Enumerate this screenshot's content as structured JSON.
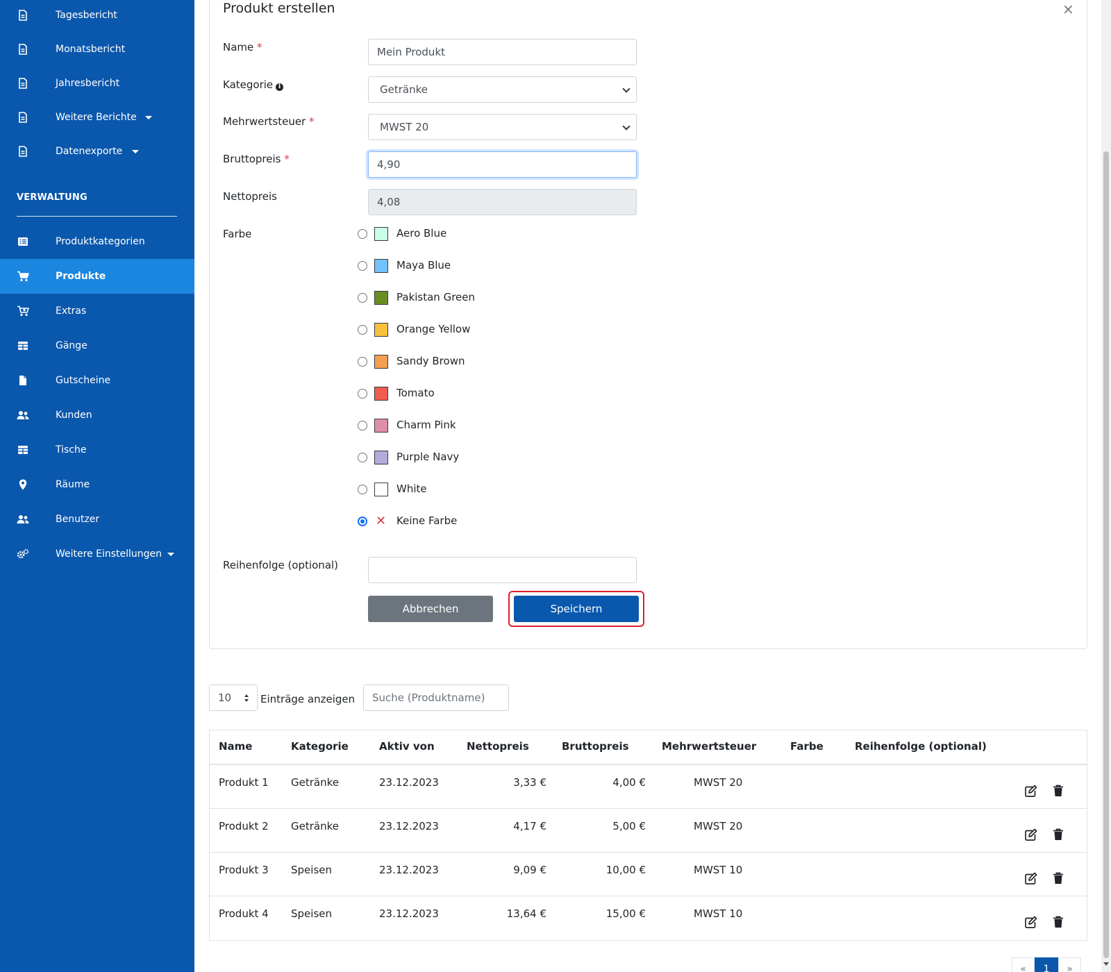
{
  "sidebar": {
    "items_top": [
      {
        "label": "Tagesbericht",
        "icon": "file-icon"
      },
      {
        "label": "Monatsbericht",
        "icon": "file-icon"
      },
      {
        "label": "Jahresbericht",
        "icon": "file-icon"
      },
      {
        "label": "Weitere Berichte",
        "icon": "file-icon",
        "dropdown": true
      },
      {
        "label": "Datenexporte",
        "icon": "file-icon",
        "dropdown": true
      }
    ],
    "section_title": "VERWALTUNG",
    "items": [
      {
        "label": "Produktkategorien",
        "icon": "list-icon"
      },
      {
        "label": "Produkte",
        "icon": "cart-icon",
        "active": true
      },
      {
        "label": "Extras",
        "icon": "cart-plus-icon"
      },
      {
        "label": "Gänge",
        "icon": "table-icon"
      },
      {
        "label": "Gutscheine",
        "icon": "file-solid-icon"
      },
      {
        "label": "Kunden",
        "icon": "users-icon"
      },
      {
        "label": "Tische",
        "icon": "table-icon"
      },
      {
        "label": "Räume",
        "icon": "map-marker-icon"
      },
      {
        "label": "Benutzer",
        "icon": "users-icon"
      },
      {
        "label": "Weitere Einstellungen",
        "icon": "cogs-icon",
        "dropdown": true
      }
    ],
    "colors": {
      "bg": "#0a58ad",
      "active": "#1a86e0"
    }
  },
  "form": {
    "title": "Produkt erstellen",
    "close": "×",
    "required_mark": "*",
    "name_label": "Name",
    "name_value": "Mein Produkt",
    "kategorie_label": "Kategorie",
    "kategorie_info": "i",
    "kategorie_value": "Getränke",
    "mwst_label": "Mehrwertsteuer",
    "mwst_value": "MWST 20",
    "brutto_label": "Bruttopreis",
    "brutto_value": "4,90",
    "netto_label": "Nettopreis",
    "netto_value": "4,08",
    "farbe_label": "Farbe",
    "colors": [
      {
        "label": "Aero Blue",
        "hex": "#c9ffe5"
      },
      {
        "label": "Maya Blue",
        "hex": "#73c2fb"
      },
      {
        "label": "Pakistan Green",
        "hex": "#6b8e23"
      },
      {
        "label": "Orange Yellow",
        "hex": "#f8c03c"
      },
      {
        "label": "Sandy Brown",
        "hex": "#f4a050"
      },
      {
        "label": "Tomato",
        "hex": "#f25c4e"
      },
      {
        "label": "Charm Pink",
        "hex": "#e08daa"
      },
      {
        "label": "Purple Navy",
        "hex": "#b1acdb"
      },
      {
        "label": "White",
        "hex": "#ffffff"
      },
      {
        "label": "Keine Farbe",
        "hex": "",
        "none": true,
        "checked": true
      }
    ],
    "reihenfolge_label": "Reihenfolge (optional)",
    "reihenfolge_value": "",
    "cancel_label": "Abbrechen",
    "save_label": "Speichern"
  },
  "list": {
    "length_value": "10",
    "length_label": "Einträge anzeigen",
    "search_placeholder": "Suche (Produktname)",
    "headers": [
      "Name",
      "Kategorie",
      "Aktiv von",
      "Nettopreis",
      "Bruttopreis",
      "Mehrwertsteuer",
      "Farbe",
      "Reihenfolge (optional)"
    ],
    "rows": [
      {
        "name": "Produkt 1",
        "kategorie": "Getränke",
        "aktiv_von": "23.12.2023",
        "netto": "3,33 €",
        "brutto": "4,00 €",
        "mwst": "MWST 20",
        "farbe": "",
        "reihenfolge": ""
      },
      {
        "name": "Produkt 2",
        "kategorie": "Getränke",
        "aktiv_von": "23.12.2023",
        "netto": "4,17 €",
        "brutto": "5,00 €",
        "mwst": "MWST 20",
        "farbe": "",
        "reihenfolge": ""
      },
      {
        "name": "Produkt 3",
        "kategorie": "Speisen",
        "aktiv_von": "23.12.2023",
        "netto": "9,09 €",
        "brutto": "10,00 €",
        "mwst": "MWST 10",
        "farbe": "",
        "reihenfolge": ""
      },
      {
        "name": "Produkt 4",
        "kategorie": "Speisen",
        "aktiv_von": "23.12.2023",
        "netto": "13,64 €",
        "brutto": "15,00 €",
        "mwst": "MWST 10",
        "farbe": "",
        "reihenfolge": ""
      }
    ],
    "pagination": {
      "prev": "«",
      "current": "1",
      "next": "»"
    }
  }
}
